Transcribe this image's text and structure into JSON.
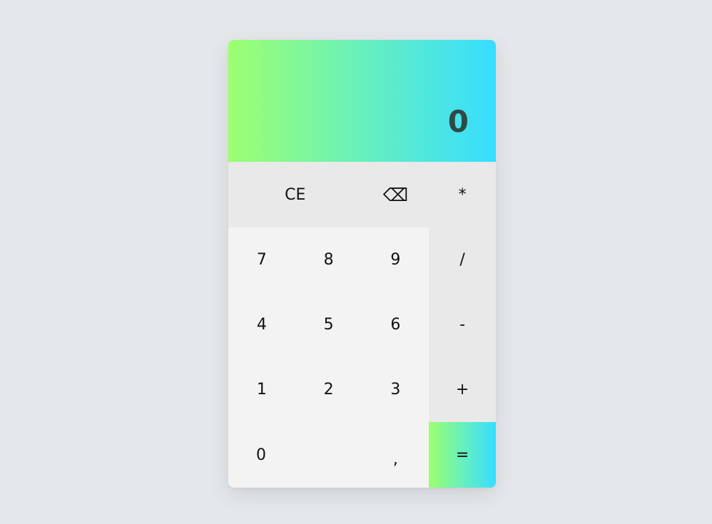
{
  "display": {
    "value": "0"
  },
  "keys": {
    "ce": "CE",
    "backspace": "⌫",
    "multiply": "*",
    "seven": "7",
    "eight": "8",
    "nine": "9",
    "divide": "/",
    "four": "4",
    "five": "5",
    "six": "6",
    "minus": "-",
    "one": "1",
    "two": "2",
    "three": "3",
    "plus": "+",
    "zero": "0",
    "comma": ",",
    "equals": "="
  },
  "colors": {
    "page_background": "#e5e8eb",
    "gradient_start": "#9dff6f",
    "gradient_end": "#37ddff",
    "number_key_background": "#f3f3f3",
    "function_key_background": "#e9e9e9",
    "display_text": "#2f4a45"
  }
}
